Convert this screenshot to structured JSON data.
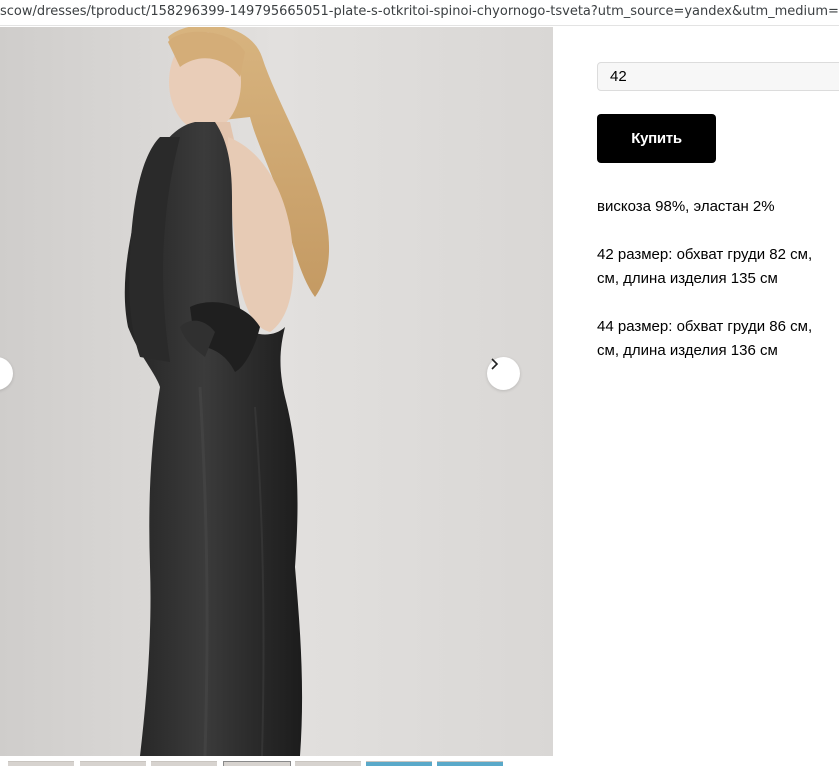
{
  "browser": {
    "url": "scow/dresses/tproduct/158296399-149795665051-plate-s-otkritoi-spinoi-chyornogo-tsveta?utm_source=yandex&utm_medium=cpc&u"
  },
  "gallery": {
    "next_icon": "chevron-right-icon",
    "prev_icon": "chevron-left-icon",
    "thumbnails": [
      {
        "state": "normal"
      },
      {
        "state": "normal"
      },
      {
        "state": "normal"
      },
      {
        "state": "active"
      },
      {
        "state": "normal"
      },
      {
        "state": "blue"
      },
      {
        "state": "blue"
      }
    ]
  },
  "product": {
    "size_value": "42",
    "buy_label": "Купить",
    "composition": "вискоза 98%, эластан 2%",
    "size42_line1": "42 размер: обхват груди 82 см,",
    "size42_line2": "см, длина изделия 135 см",
    "size44_line1": "44 размер: обхват груди 86 см,",
    "size44_line2": "см, длина изделия 136 см"
  },
  "colors": {
    "button_bg": "#000000",
    "button_text": "#ffffff",
    "photo_bg": "#dcdad8"
  }
}
